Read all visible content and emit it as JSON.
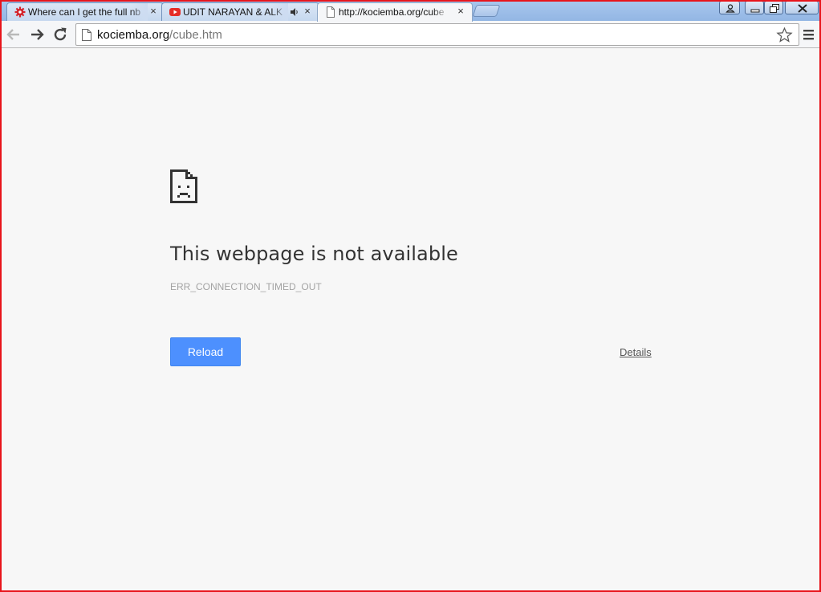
{
  "tabs": [
    {
      "title": "Where can I get the full nb",
      "favicon": "red-gear-icon",
      "close": "×"
    },
    {
      "title": "UDIT NARAYAN & ALK",
      "favicon": "youtube-icon",
      "audio_icon": "speaker-icon",
      "close": "×"
    },
    {
      "title": "http://kociemba.org/cube",
      "favicon": "page-icon",
      "close": "×",
      "active": true
    }
  ],
  "window_controls": [
    "user-icon",
    "minimize-icon",
    "restore-icon",
    "close-icon"
  ],
  "toolbar": {
    "url_host": "kociemba.org",
    "url_path": "/cube.htm",
    "bookmark_icon": "star-icon",
    "menu_icon": "hamburger-menu-icon"
  },
  "error": {
    "title": "This webpage is not available",
    "code": "ERR_CONNECTION_TIMED_OUT",
    "reload_label": "Reload",
    "details_label": "Details"
  },
  "colors": {
    "frame": "#e8141b",
    "reload_button": "#4d90fe",
    "page_background": "#f7f7f7"
  }
}
